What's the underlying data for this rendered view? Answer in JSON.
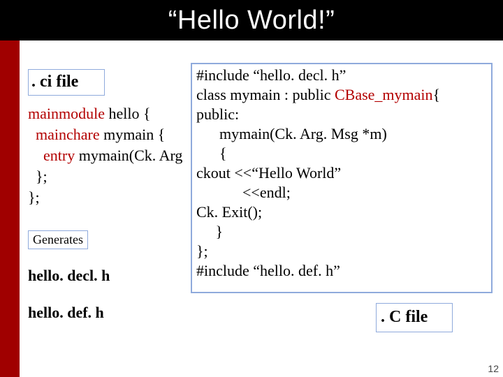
{
  "title": "“Hello World!”",
  "ci_label": ". ci  file",
  "ci_code": {
    "l1a": "mainmodule",
    "l1b": " hello {",
    "l2a": "  mainchare",
    "l2b": " mymain {",
    "l3a": "    entry",
    "l3b": " mymain(Ck. Arg",
    "l4": "  };",
    "l5": "};"
  },
  "generates": "Generates",
  "hello_decl_h": "hello. decl. h",
  "hello_def_h": "hello. def. h",
  "c_code": {
    "l1": "#include “hello. decl. h”",
    "l2a": "class mymain : public ",
    "l2b": "CBase_mymain",
    "l2c": "{",
    "l3": "public:",
    "l4": "      mymain(Ck. Arg. Msg *m)",
    "l5": "      {",
    "l6": "ckout <<“Hello World”",
    "l7": "            <<endl;",
    "l8": "Ck. Exit();",
    "l9": "     }",
    "l10": "};",
    "l11": "#include “hello. def. h”"
  },
  "cfile_label": ". C file",
  "page_number": "12"
}
